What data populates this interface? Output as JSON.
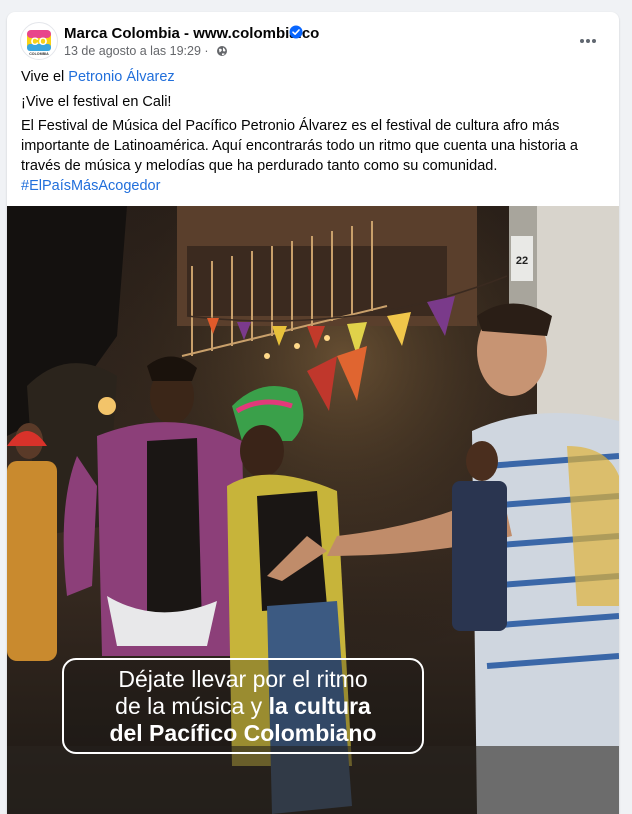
{
  "post": {
    "author": "Marca Colombia - www.colombia.co",
    "timestamp": "13 de agosto a las 19:29",
    "separator": "·",
    "intro_prefix": "Vive el",
    "intro_link": "Petronio Álvarez",
    "headline": "¡Vive el festival en Cali!",
    "body": "El Festival de Música del Pacífico Petronio Álvarez es el festival de cultura afro más importante de Latinoamérica. Aquí encontrarás todo un ritmo que cuenta una historia a través de música y melodías que ha perdurado tanto como su comunidad.",
    "hashtag": "#ElPaísMásAcogedor",
    "avatar_text": "CO",
    "avatar_sub": "COLOMBIA"
  },
  "image": {
    "caption_line1": "Déjate llevar por el ritmo",
    "caption_line2_normal": "de la música y",
    "caption_line2_bold": "la cultura",
    "caption_line3": "del Pacífico Colombiano",
    "sign_text": "22"
  },
  "icons": {
    "verified": "verified-badge-icon",
    "globe": "globe-icon",
    "more": "more-options-icon"
  },
  "colors": {
    "link": "#216fdb",
    "verified": "#0866ff",
    "background": "#f0f2f5"
  }
}
